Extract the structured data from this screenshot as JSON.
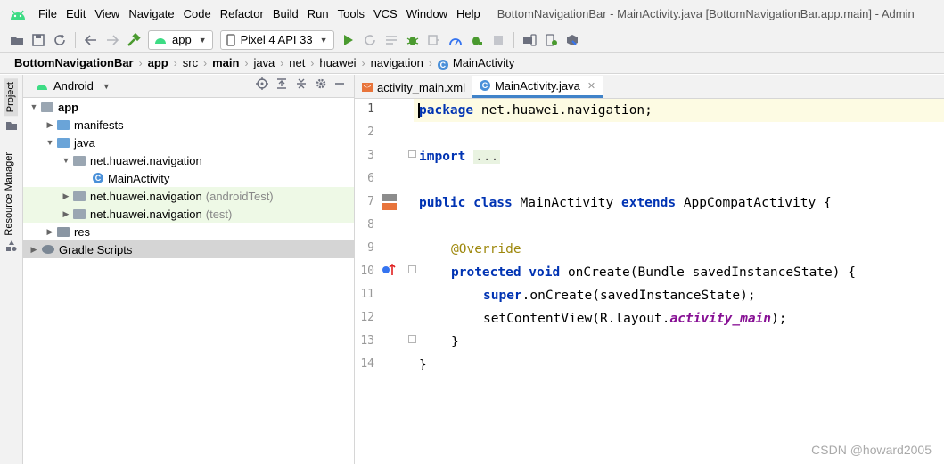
{
  "menubar": {
    "items": [
      "File",
      "Edit",
      "View",
      "Navigate",
      "Code",
      "Refactor",
      "Build",
      "Run",
      "Tools",
      "VCS",
      "Window",
      "Help"
    ],
    "window_title": "BottomNavigationBar - MainActivity.java [BottomNavigationBar.app.main] - Admin"
  },
  "toolbar": {
    "module_combo": "app",
    "device_combo": "Pixel 4 API 33"
  },
  "breadcrumb": [
    "BottomNavigationBar",
    "app",
    "src",
    "main",
    "java",
    "net",
    "huawei",
    "navigation",
    "MainActivity"
  ],
  "sidebar": {
    "tab_project": "Project",
    "tab_resource_manager": "Resource Manager"
  },
  "project_panel": {
    "view_selector": "Android",
    "tree": {
      "app": "app",
      "manifests": "manifests",
      "java": "java",
      "pkg_main": "net.huawei.navigation",
      "main_activity": "MainActivity",
      "pkg_android_test": "net.huawei.navigation",
      "pkg_android_test_suffix": "(androidTest)",
      "pkg_test": "net.huawei.navigation",
      "pkg_test_suffix": "(test)",
      "res": "res",
      "gradle_scripts": "Gradle Scripts"
    }
  },
  "editor": {
    "tabs": [
      {
        "label": "activity_main.xml",
        "active": false
      },
      {
        "label": "MainActivity.java",
        "active": true
      }
    ],
    "line_numbers": [
      "1",
      "2",
      "3",
      "6",
      "7",
      "8",
      "9",
      "10",
      "11",
      "12",
      "13",
      "14"
    ],
    "code": {
      "l1_kw": "package",
      "l1_rest": " net.huawei.navigation;",
      "l3_kw": "import",
      "l3_fold": "...",
      "l7_kw1": "public class",
      "l7_name": " MainActivity ",
      "l7_kw2": "extends",
      "l7_rest": " AppCompatActivity {",
      "l9_ann": "@Override",
      "l10_kw": "protected void",
      "l10_rest": " onCreate(Bundle savedInstanceState) {",
      "l11_kw": "super",
      "l11_rest": ".onCreate(savedInstanceState);",
      "l12_start": "setContentView(R.layout.",
      "l12_field": "activity_main",
      "l12_end": ");",
      "l13": "}",
      "l14": "}"
    }
  },
  "watermark": "CSDN @howard2005"
}
